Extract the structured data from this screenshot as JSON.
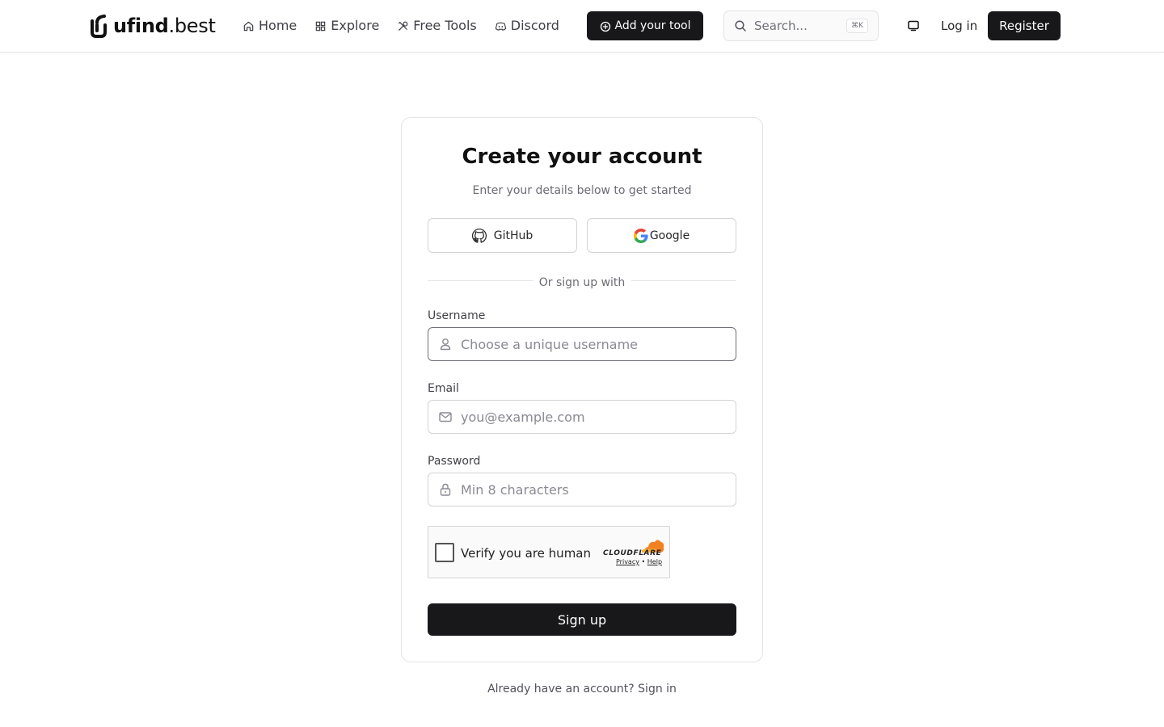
{
  "header": {
    "logo_name": "ufind",
    "logo_tld": ".best",
    "nav": [
      {
        "label": "Home",
        "icon": "home-icon"
      },
      {
        "label": "Explore",
        "icon": "grid-icon"
      },
      {
        "label": "Free Tools",
        "icon": "tools-icon"
      },
      {
        "label": "Discord",
        "icon": "discord-icon"
      }
    ],
    "add_tool_label": "Add your tool",
    "search_placeholder": "Search...",
    "search_shortcut": "⌘K",
    "login_label": "Log in",
    "register_label": "Register"
  },
  "card": {
    "title": "Create your account",
    "subtitle": "Enter your details below to get started",
    "github_label": "GitHub",
    "google_label": "Google",
    "divider_label": "Or sign up with",
    "username_label": "Username",
    "username_placeholder": "Choose a unique username",
    "email_label": "Email",
    "email_placeholder": "you@example.com",
    "password_label": "Password",
    "password_placeholder": "Min 8 characters",
    "captcha_label": "Verify you are human",
    "captcha_brand": "CLOUDFLARE",
    "captcha_privacy": "Privacy",
    "captcha_sep": "•",
    "captcha_help": "Help",
    "signup_label": "Sign up"
  },
  "footer": {
    "prompt": "Already have an account?",
    "signin_label": "Sign in"
  },
  "colors": {
    "primary": "#18181b",
    "border": "#e4e4e7",
    "muted_text": "#6b6b73",
    "cloudflare_orange": "#f48120"
  }
}
